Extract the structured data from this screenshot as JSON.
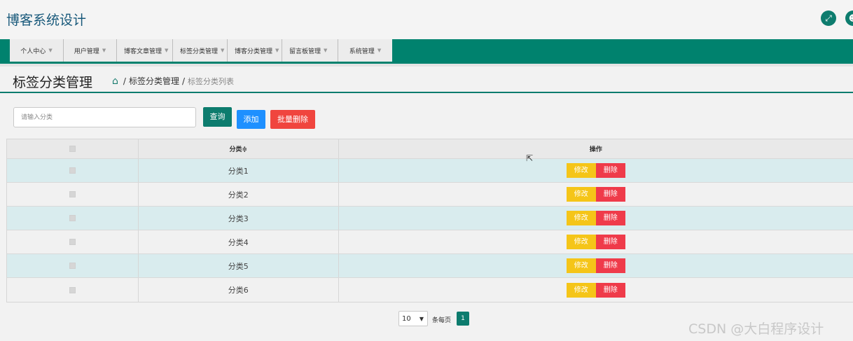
{
  "app": {
    "title": "博客系统设计"
  },
  "header_icons": [
    "expand-icon",
    "user-icon"
  ],
  "nav": {
    "items": [
      {
        "label": "个人中心"
      },
      {
        "label": "用户管理"
      },
      {
        "label": "博客文章管理"
      },
      {
        "label": "标签分类管理"
      },
      {
        "label": "博客分类管理"
      },
      {
        "label": "留言板管理"
      },
      {
        "label": "系统管理"
      }
    ]
  },
  "page": {
    "title": "标签分类管理",
    "breadcrumb": [
      "标签分类管理",
      "标签分类列表"
    ]
  },
  "toolbar": {
    "search_placeholder": "请输入分类",
    "query_label": "查询",
    "add_label": "添加",
    "batch_delete_label": "批量删除"
  },
  "table": {
    "headers": {
      "category": "分类≑",
      "actions": "操作"
    },
    "rows": [
      {
        "name": "分类1"
      },
      {
        "name": "分类2"
      },
      {
        "name": "分类3"
      },
      {
        "name": "分类4"
      },
      {
        "name": "分类5"
      },
      {
        "name": "分类6"
      }
    ],
    "edit_label": "修改",
    "delete_label": "删除"
  },
  "pagination": {
    "page_size": "10",
    "per_page_label": "条每页",
    "current_page": "1"
  },
  "watermark": "CSDN @大白程序设计",
  "colors": {
    "primary": "#0d7c6e",
    "nav": "#00826e",
    "add": "#1e90ff",
    "danger": "#ef3b4a",
    "edit": "#f5c518",
    "row_alt": "#d9ecee"
  }
}
